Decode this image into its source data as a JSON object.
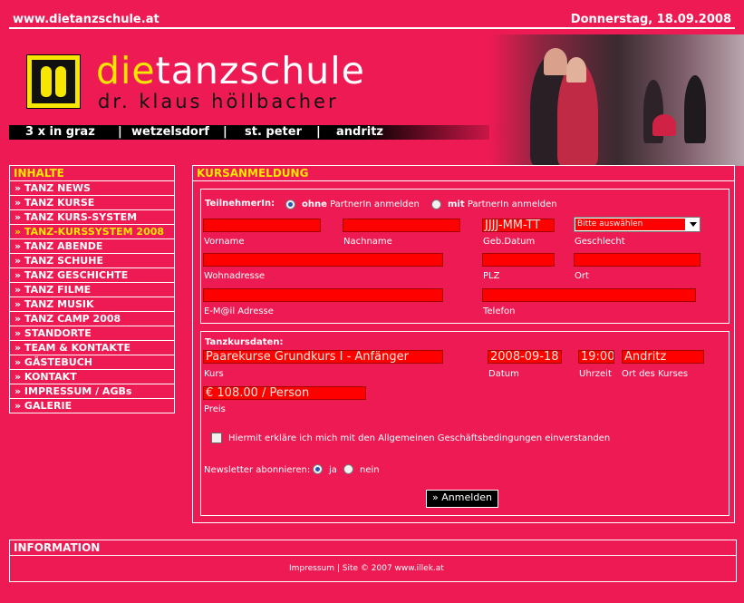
{
  "header": {
    "url": "www.dietanzschule.at",
    "date": "Donnerstag, 18.09.2008",
    "brand_die": "die",
    "brand_rest": "tanzschule",
    "subtitle": "dr. klaus höllbacher",
    "locations": [
      "3 x in graz",
      "|",
      "wetzelsdorf",
      "|",
      "st. peter",
      "|",
      "andritz"
    ]
  },
  "sidebar": {
    "heading": "INHALTE",
    "items": [
      {
        "label": "» TANZ NEWS"
      },
      {
        "label": "» TANZ KURSE"
      },
      {
        "label": "» TANZ KURS-SYSTEM"
      },
      {
        "label": "» TANZ-KURSSYSTEM 2008",
        "active": true
      },
      {
        "label": "» TANZ ABENDE"
      },
      {
        "label": "» TANZ SCHUHE"
      },
      {
        "label": "» TANZ GESCHICHTE"
      },
      {
        "label": "» TANZ FILME"
      },
      {
        "label": "» TANZ MUSIK"
      },
      {
        "label": "» TANZ CAMP 2008"
      },
      {
        "label": "» STANDORTE"
      },
      {
        "label": "» TEAM & KONTAKTE"
      },
      {
        "label": "» GÄSTEBUCH"
      },
      {
        "label": "» KONTAKT"
      },
      {
        "label": "» IMPRESSUM / AGBs"
      },
      {
        "label": "» GALERIE"
      }
    ]
  },
  "form": {
    "heading": "KURSANMELDUNG",
    "participant_label": "TeilnehmerIn:",
    "option_without_bold": "ohne",
    "option_without_rest": "PartnerIn anmelden",
    "option_with_bold": "mit",
    "option_with_rest": "PartnerIn anmelden",
    "fields": {
      "vorname": "Vorname",
      "nachname": "Nachname",
      "geb_datum": "Geb.Datum",
      "geb_datum_value": "JJJJ-MM-TT",
      "geschlecht": "Geschlecht",
      "geschlecht_value": "Bitte auswählen",
      "wohnadresse": "Wohnadresse",
      "plz": "PLZ",
      "ort": "Ort",
      "email": "E-M@il Adresse",
      "telefon": "Telefon"
    },
    "course": {
      "heading": "Tanzkursdaten:",
      "kurs_value": "Paarekurse Grundkurs I - Anfänger",
      "kurs_label": "Kurs",
      "datum_value": "2008-09-18",
      "datum_label": "Datum",
      "uhrzeit_value": "19:00",
      "uhrzeit_label": "Uhrzeit",
      "ort_value": "Andritz",
      "ort_label": "Ort des Kurses",
      "preis_value": "€ 108.00 / Person",
      "preis_label": "Preis"
    },
    "agb_text": "Hiermit erkläre ich mich mit den Allgemeinen Geschäftsbedingungen einverstanden",
    "newsletter_label": "Newsletter abonnieren:",
    "newsletter_yes": "ja",
    "newsletter_no": "nein",
    "submit": "» Anmelden"
  },
  "info": {
    "heading": "INFORMATION",
    "footer": "Impressum | Site © 2007 www.illek.at"
  }
}
